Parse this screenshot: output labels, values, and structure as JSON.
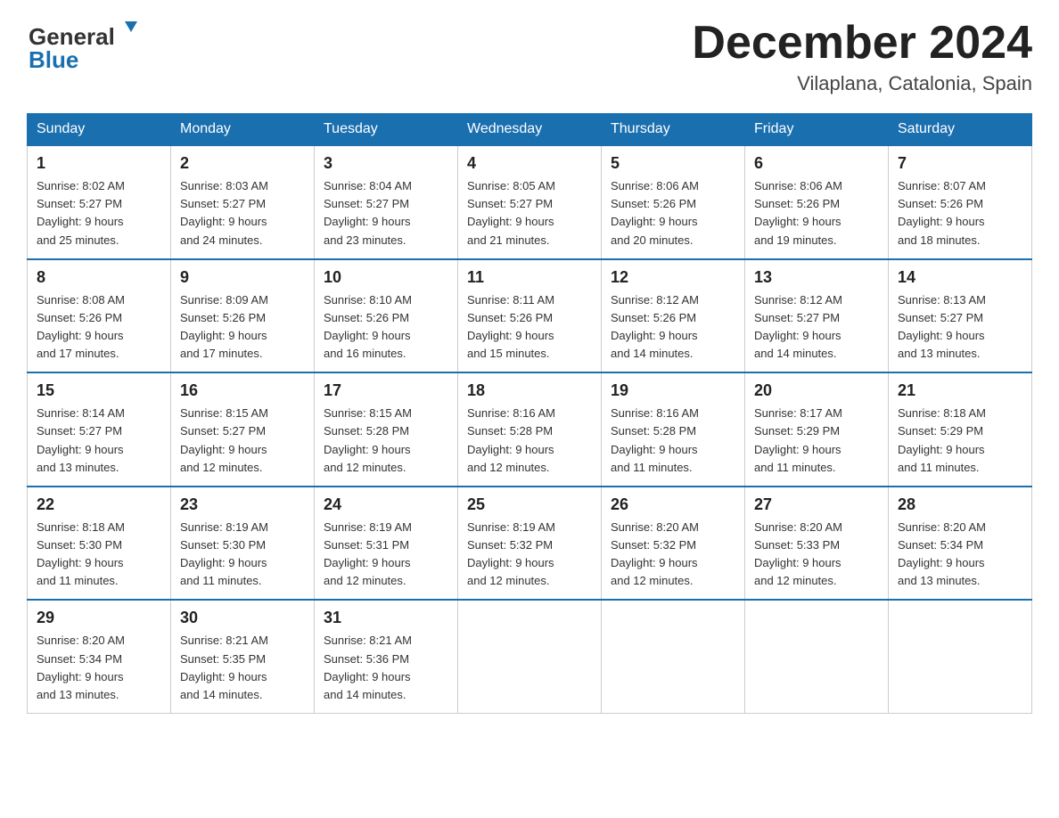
{
  "header": {
    "logo_general": "General",
    "logo_blue": "Blue",
    "month_title": "December 2024",
    "location": "Vilaplana, Catalonia, Spain"
  },
  "days_of_week": [
    "Sunday",
    "Monday",
    "Tuesday",
    "Wednesday",
    "Thursday",
    "Friday",
    "Saturday"
  ],
  "weeks": [
    [
      {
        "day": "1",
        "sunrise": "8:02 AM",
        "sunset": "5:27 PM",
        "daylight": "9 hours and 25 minutes."
      },
      {
        "day": "2",
        "sunrise": "8:03 AM",
        "sunset": "5:27 PM",
        "daylight": "9 hours and 24 minutes."
      },
      {
        "day": "3",
        "sunrise": "8:04 AM",
        "sunset": "5:27 PM",
        "daylight": "9 hours and 23 minutes."
      },
      {
        "day": "4",
        "sunrise": "8:05 AM",
        "sunset": "5:27 PM",
        "daylight": "9 hours and 21 minutes."
      },
      {
        "day": "5",
        "sunrise": "8:06 AM",
        "sunset": "5:26 PM",
        "daylight": "9 hours and 20 minutes."
      },
      {
        "day": "6",
        "sunrise": "8:06 AM",
        "sunset": "5:26 PM",
        "daylight": "9 hours and 19 minutes."
      },
      {
        "day": "7",
        "sunrise": "8:07 AM",
        "sunset": "5:26 PM",
        "daylight": "9 hours and 18 minutes."
      }
    ],
    [
      {
        "day": "8",
        "sunrise": "8:08 AM",
        "sunset": "5:26 PM",
        "daylight": "9 hours and 17 minutes."
      },
      {
        "day": "9",
        "sunrise": "8:09 AM",
        "sunset": "5:26 PM",
        "daylight": "9 hours and 17 minutes."
      },
      {
        "day": "10",
        "sunrise": "8:10 AM",
        "sunset": "5:26 PM",
        "daylight": "9 hours and 16 minutes."
      },
      {
        "day": "11",
        "sunrise": "8:11 AM",
        "sunset": "5:26 PM",
        "daylight": "9 hours and 15 minutes."
      },
      {
        "day": "12",
        "sunrise": "8:12 AM",
        "sunset": "5:26 PM",
        "daylight": "9 hours and 14 minutes."
      },
      {
        "day": "13",
        "sunrise": "8:12 AM",
        "sunset": "5:27 PM",
        "daylight": "9 hours and 14 minutes."
      },
      {
        "day": "14",
        "sunrise": "8:13 AM",
        "sunset": "5:27 PM",
        "daylight": "9 hours and 13 minutes."
      }
    ],
    [
      {
        "day": "15",
        "sunrise": "8:14 AM",
        "sunset": "5:27 PM",
        "daylight": "9 hours and 13 minutes."
      },
      {
        "day": "16",
        "sunrise": "8:15 AM",
        "sunset": "5:27 PM",
        "daylight": "9 hours and 12 minutes."
      },
      {
        "day": "17",
        "sunrise": "8:15 AM",
        "sunset": "5:28 PM",
        "daylight": "9 hours and 12 minutes."
      },
      {
        "day": "18",
        "sunrise": "8:16 AM",
        "sunset": "5:28 PM",
        "daylight": "9 hours and 12 minutes."
      },
      {
        "day": "19",
        "sunrise": "8:16 AM",
        "sunset": "5:28 PM",
        "daylight": "9 hours and 11 minutes."
      },
      {
        "day": "20",
        "sunrise": "8:17 AM",
        "sunset": "5:29 PM",
        "daylight": "9 hours and 11 minutes."
      },
      {
        "day": "21",
        "sunrise": "8:18 AM",
        "sunset": "5:29 PM",
        "daylight": "9 hours and 11 minutes."
      }
    ],
    [
      {
        "day": "22",
        "sunrise": "8:18 AM",
        "sunset": "5:30 PM",
        "daylight": "9 hours and 11 minutes."
      },
      {
        "day": "23",
        "sunrise": "8:19 AM",
        "sunset": "5:30 PM",
        "daylight": "9 hours and 11 minutes."
      },
      {
        "day": "24",
        "sunrise": "8:19 AM",
        "sunset": "5:31 PM",
        "daylight": "9 hours and 12 minutes."
      },
      {
        "day": "25",
        "sunrise": "8:19 AM",
        "sunset": "5:32 PM",
        "daylight": "9 hours and 12 minutes."
      },
      {
        "day": "26",
        "sunrise": "8:20 AM",
        "sunset": "5:32 PM",
        "daylight": "9 hours and 12 minutes."
      },
      {
        "day": "27",
        "sunrise": "8:20 AM",
        "sunset": "5:33 PM",
        "daylight": "9 hours and 12 minutes."
      },
      {
        "day": "28",
        "sunrise": "8:20 AM",
        "sunset": "5:34 PM",
        "daylight": "9 hours and 13 minutes."
      }
    ],
    [
      {
        "day": "29",
        "sunrise": "8:20 AM",
        "sunset": "5:34 PM",
        "daylight": "9 hours and 13 minutes."
      },
      {
        "day": "30",
        "sunrise": "8:21 AM",
        "sunset": "5:35 PM",
        "daylight": "9 hours and 14 minutes."
      },
      {
        "day": "31",
        "sunrise": "8:21 AM",
        "sunset": "5:36 PM",
        "daylight": "9 hours and 14 minutes."
      },
      null,
      null,
      null,
      null
    ]
  ],
  "labels": {
    "sunrise": "Sunrise:",
    "sunset": "Sunset:",
    "daylight": "Daylight:"
  }
}
